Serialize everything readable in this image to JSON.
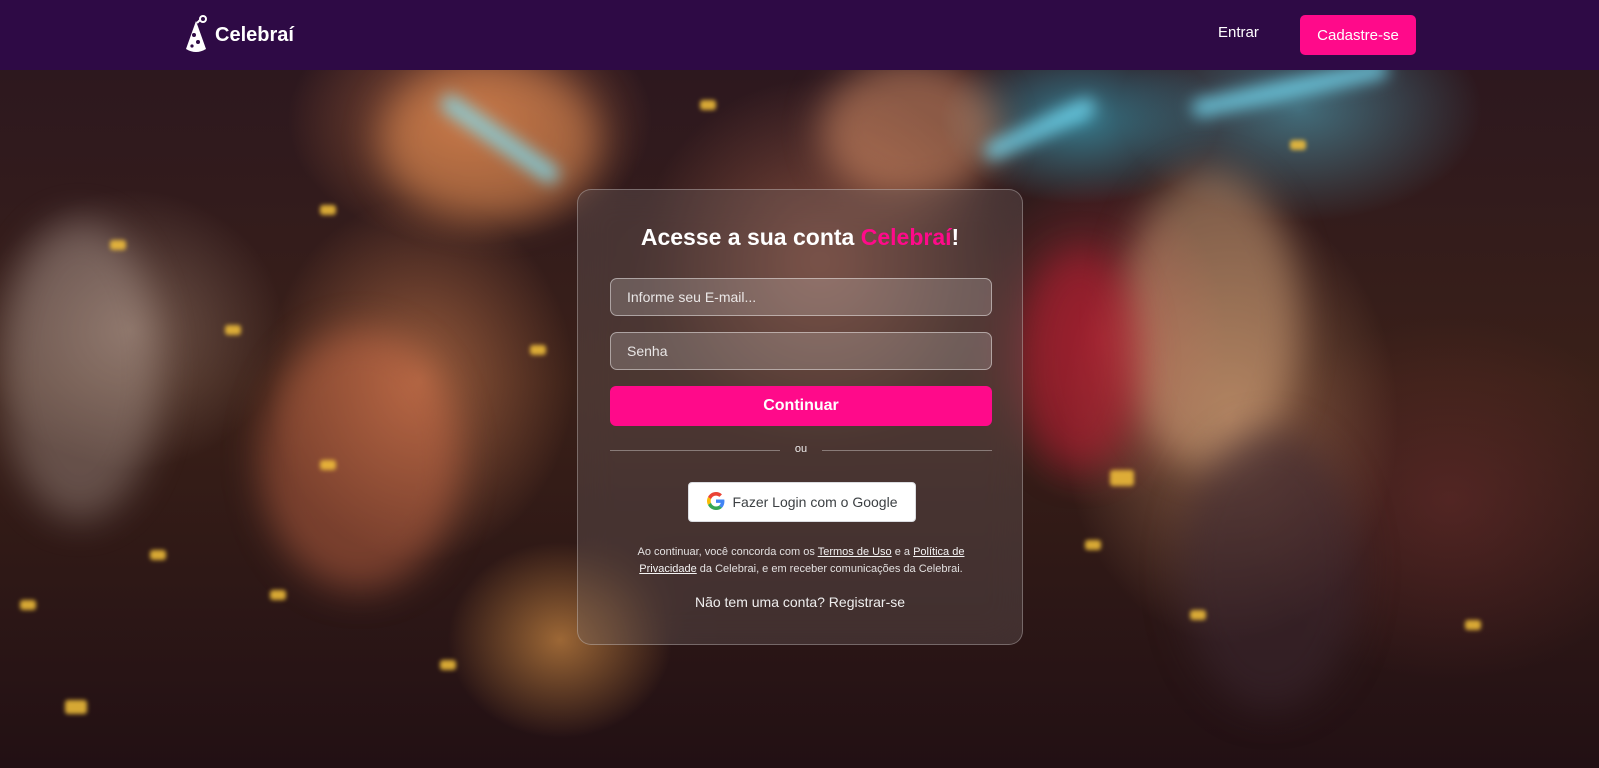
{
  "header": {
    "brand": "Celebraí",
    "login_label": "Entrar",
    "signup_label": "Cadastre-se",
    "background_color": "#2e0a45",
    "accent_color": "#ff0a8a"
  },
  "card": {
    "title_prefix": "Acesse a sua conta ",
    "title_brand": "Celebraí",
    "title_suffix": "!",
    "email_placeholder": "Informe seu E-mail...",
    "password_placeholder": "Senha",
    "continue_label": "Continuar",
    "divider_text": "ou",
    "google_label": "Fazer Login com o Google",
    "terms": {
      "part1": "Ao continuar, você concorda com os ",
      "terms_link": "Termos de Uso",
      "part2": " e a ",
      "privacy_link": "Política de Privacidade",
      "part3": " da Celebrai, e em receber comunicações da Celebrai."
    },
    "register_text": "Não tem uma conta? Registrar-se"
  },
  "icons": {
    "logo": "party-hat-icon",
    "google": "google-icon"
  }
}
